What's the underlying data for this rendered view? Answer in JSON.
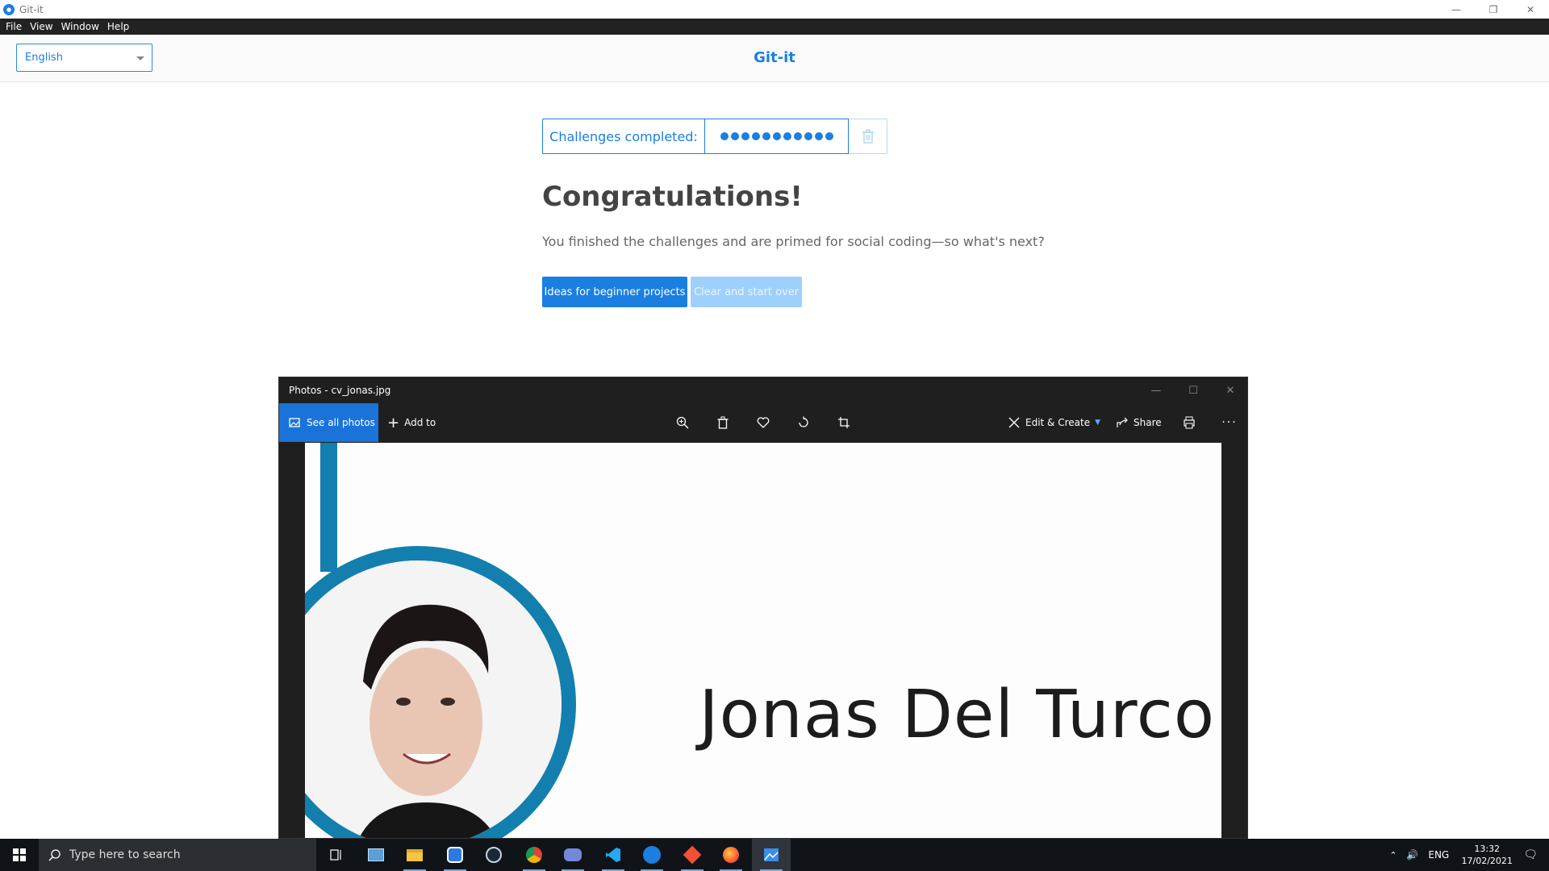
{
  "window": {
    "title": "Git-it",
    "menu": [
      "File",
      "View",
      "Window",
      "Help"
    ]
  },
  "header": {
    "language": "English",
    "brand": "Git-it"
  },
  "main": {
    "progress_label": "Challenges completed:",
    "challenges_completed": 11,
    "heading": "Congratulations!",
    "subtitle": "You finished the challenges and are primed for social coding—so what's next?",
    "primary_button": "Ideas for beginner projects",
    "secondary_button": "Clear and start over"
  },
  "photos": {
    "title": "Photos - cv_jonas.jpg",
    "see_all": "See all photos",
    "add_to": "Add to",
    "edit_create": "Edit & Create",
    "share": "Share",
    "image_text": "Jonas Del Turco"
  },
  "taskbar": {
    "search_placeholder": "Type here to search",
    "language": "ENG",
    "time": "13:32",
    "date": "17/02/2021"
  },
  "colors": {
    "accent": "#1a7fe0",
    "cv_accent": "#137fae"
  }
}
